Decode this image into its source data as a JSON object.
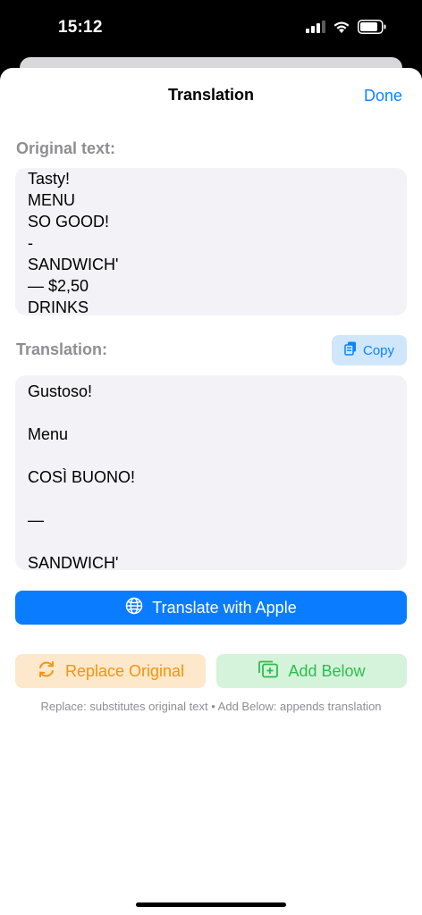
{
  "status_bar": {
    "time": "15:12",
    "icons": [
      "cellular-signal-icon",
      "wifi-icon",
      "battery-icon"
    ]
  },
  "nav": {
    "title": "Translation",
    "done_label": "Done"
  },
  "original": {
    "label": "Original text:",
    "lines": [
      "Tasty!",
      "MENU",
      "SO GOOD!",
      "-",
      "SANDWICH'",
      "— $2,50",
      "DRINKS"
    ]
  },
  "translation": {
    "label": "Translation:",
    "copy_label": "Copy",
    "lines": [
      "Gustoso!",
      "",
      "Menu",
      "",
      "COSÌ BUONO!",
      "",
      "—",
      "",
      "SANDWICH'"
    ]
  },
  "actions": {
    "translate_label": "Translate with Apple",
    "replace_label": "Replace Original",
    "add_below_label": "Add Below",
    "hint": "Replace: substitutes original text • Add Below: appends translation"
  },
  "colors": {
    "accent": "#0a84ff",
    "replace": "#f5930b",
    "add_below": "#2dbd4e"
  }
}
